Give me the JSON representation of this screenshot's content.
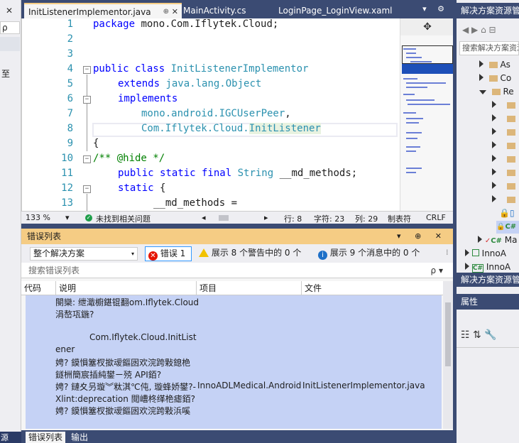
{
  "left_strip": {
    "search_glyph": "ρ",
    "chevron": "▾",
    "clipped_text": "至",
    "bottom_label": "源"
  },
  "tabs": [
    {
      "label": "InitListenerImplementor.java",
      "active": true,
      "pin": "⊕",
      "close": "✕"
    },
    {
      "label": "MainActivity.cs",
      "active": false
    },
    {
      "label": "LoginPage_LoginView.xaml",
      "active": false
    }
  ],
  "tab_tools": "▾ ⚙",
  "editor": {
    "line_numbers": [
      "1",
      "2",
      "3",
      "4",
      "5",
      "6",
      "7",
      "8",
      "9",
      "10",
      "11",
      "12",
      "13"
    ],
    "lines": {
      "l1_kw": "package",
      "l1_rest": " mono.Com.Iflytek.Cloud;",
      "l4_kw": "public class",
      "l4_ty": " InitListenerImplementor",
      "l5_kw": "extends",
      "l5_ty": " java.lang.Object",
      "l6_kw": "implements",
      "l7_ty": "mono.android.IGCUserPeer",
      "l7_rest": ",",
      "l8_ty": "Com.Iflytek.Cloud.",
      "l8_hl": "InitListener",
      "l9": "{",
      "l10_cm": "/** @hide */",
      "l11_kw": "public static final",
      "l11_ty": " String",
      "l11_rest": " __md_methods;",
      "l12_kw": "static",
      "l12_rest": " {",
      "l13": "__md_methods ="
    },
    "fold_glyph": "−",
    "split_glyph": "✥"
  },
  "status": {
    "zoom": "133 %",
    "zoom_arrow": "▾",
    "ok_glyph": "✓",
    "message": "未找到相关问题",
    "scroll_left": "◂",
    "scroll_right": "▸",
    "line": "行: 8",
    "char": "字符: 23",
    "col": "列: 29",
    "indent": "制表符",
    "eol": "CRLF"
  },
  "error_list": {
    "title": "错误列表",
    "tools": "▾ ⊕ ✕",
    "scope": "整个解决方案",
    "scope_arrow": "▾",
    "errors_label": "错误 1",
    "error_glyph": "✕",
    "info_glyph": "i",
    "warnings_label": "展示 8 个警告中的 0 个",
    "messages_label": "展示 9 个消息中的 0 个",
    "more_glyph": "⁞",
    "search_placeholder": "搜索错误列表",
    "search_glyph": "ρ ▾",
    "columns": [
      "代码",
      "说明",
      "项目",
      "文件"
    ],
    "body_lines": [
      "閿欒: 绁濈櫥鍖锟翻om.Iflytek.Cloud",
      "涓嶅瓨鍦?",
      "Com.Iflytek.Cloud.InitList",
      "ener",
      "娉? 鏌愪簺杈撳叆鏂囦欢浣跨敤鎴栬",
      "鐩栦簡宸插純鐢ㄧ殑 API銆?",
      "娉? 鏈夊叧璇︾粏淇℃伅, 璇蜂娇鐢?-",
      "Xlint:deprecation 閲嶆柊缂栬瘧銆?",
      "娉? 鏌愪簺杈撳叆鏂囦欢浣跨敤浜嗘"
    ],
    "project": "InnoADLMedical.Android",
    "file": "InitListenerImplementor.java",
    "bottom_tabs": [
      "错误列表",
      "输出"
    ]
  },
  "solution": {
    "title": "解决方案资源管理器",
    "toolbar": "◀ ▶ ⌂ ⊟",
    "search_placeholder": "搜索解决方案资源管理器",
    "items": [
      {
        "label": "As",
        "kind": "folder"
      },
      {
        "label": "Co",
        "kind": "folder"
      },
      {
        "label": "Re",
        "kind": "folder"
      }
    ],
    "subfolders": 8,
    "files": [
      {
        "label": "",
        "kind": "lock-file"
      },
      {
        "label": "C#",
        "kind": "csharp"
      }
    ],
    "projects": [
      {
        "label": "Ma",
        "prefix": "✓ C#"
      },
      {
        "label": "InnoA",
        "prefix": ""
      },
      {
        "label": "InnoA",
        "prefix": "C#"
      }
    ],
    "bottom_label": "解决方案资源管理器"
  },
  "properties": {
    "title": "属性",
    "icons": "☷ ⇅ 🔧"
  }
}
